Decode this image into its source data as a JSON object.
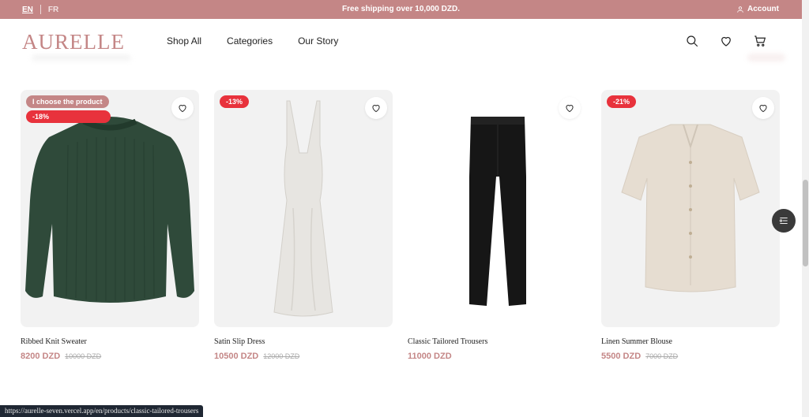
{
  "topbar": {
    "lang_en": "EN",
    "lang_fr": "FR",
    "promo": "Free shipping over 10,000 DZD.",
    "account_label": "Account"
  },
  "header": {
    "logo": "AURELLE",
    "nav": [
      "Shop All",
      "Categories",
      "Our Story"
    ]
  },
  "products": [
    {
      "name": "Ribbed Knit Sweater",
      "price": "8200 DZD",
      "old_price": "10000 DZD",
      "discount": "-18%",
      "extra_badge": "I choose the product"
    },
    {
      "name": "Satin Slip Dress",
      "price": "10500 DZD",
      "old_price": "12000 DZD",
      "discount": "-13%"
    },
    {
      "name": "Classic Tailored Trousers",
      "price": "11000 DZD",
      "old_price": "",
      "discount": ""
    },
    {
      "name": "Linen Summer Blouse",
      "price": "5500 DZD",
      "old_price": "7000 DZD",
      "discount": "-21%"
    }
  ],
  "status_url": "https://aurelle-seven.vercel.app/en/products/classic-tailored-trousers",
  "colors": {
    "brand": "#c48686",
    "sale": "#e8323c"
  }
}
